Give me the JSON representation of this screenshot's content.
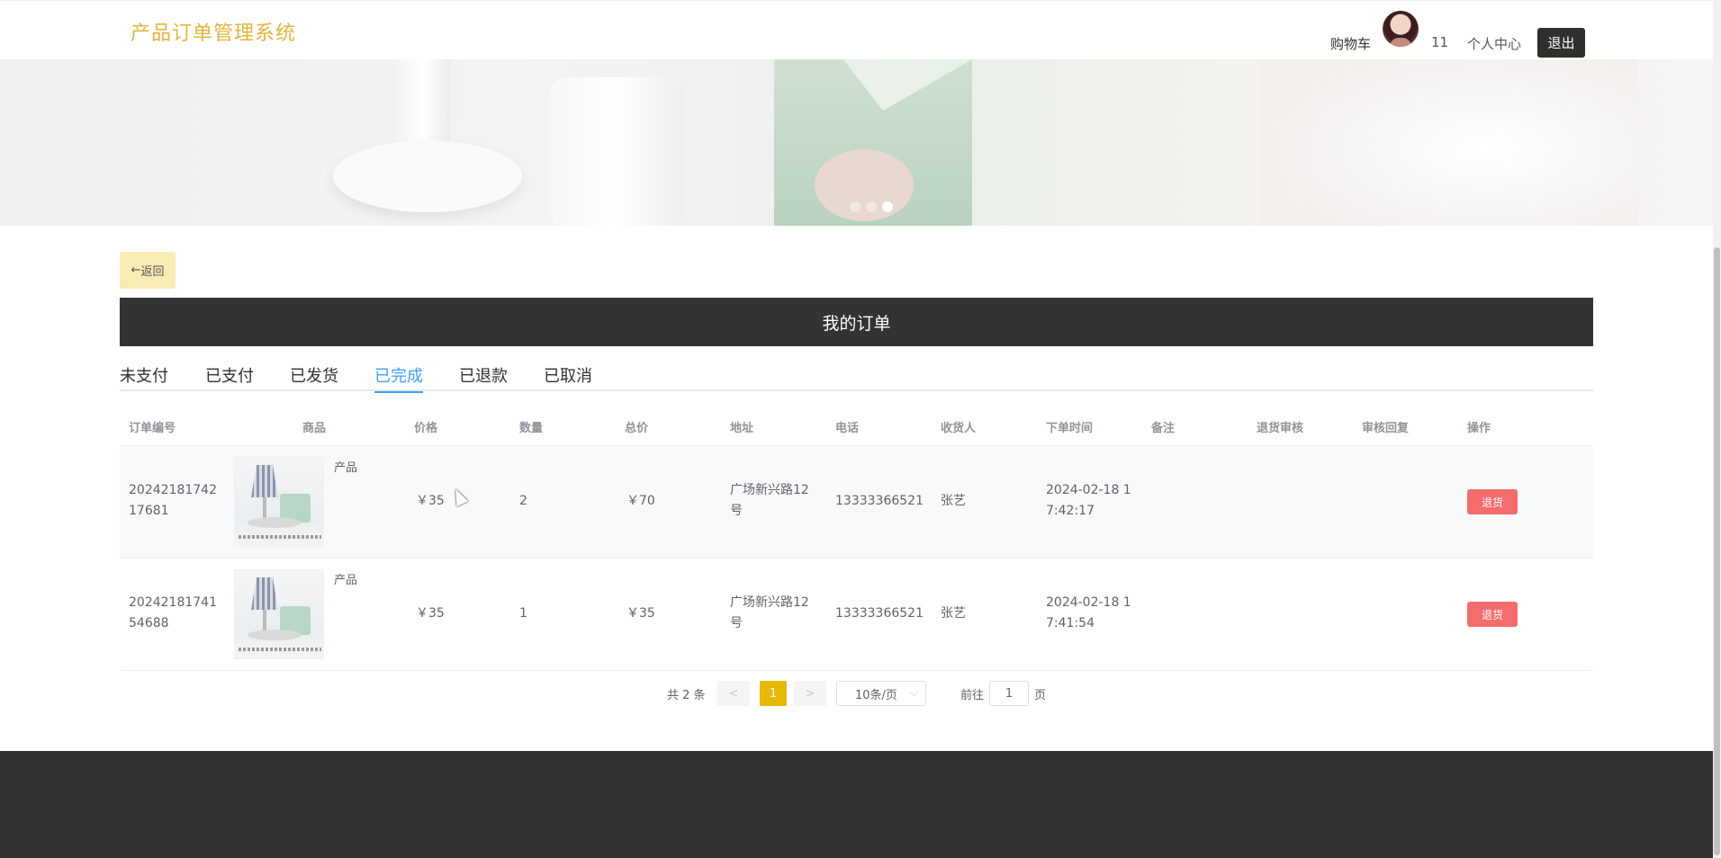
{
  "header": {
    "brand": "产品订单管理系统",
    "cart_label": "购物车",
    "user_count": "11",
    "profile_label": "个人中心",
    "logout_label": "退出"
  },
  "back_label": "返回",
  "page_title": "我的订单",
  "tabs": [
    {
      "label": "未支付",
      "active": false
    },
    {
      "label": "已支付",
      "active": false
    },
    {
      "label": "已发货",
      "active": false
    },
    {
      "label": "已完成",
      "active": true
    },
    {
      "label": "已退款",
      "active": false
    },
    {
      "label": "已取消",
      "active": false
    }
  ],
  "table": {
    "columns": [
      "订单编号",
      "商品",
      "价格",
      "数量",
      "总价",
      "地址",
      "电话",
      "收货人",
      "下单时间",
      "备注",
      "退货审核",
      "审核回复",
      "操作"
    ],
    "rows": [
      {
        "order_no_1": "20242181742",
        "order_no_2": "17681",
        "product": "产品",
        "price": "￥35",
        "qty": "2",
        "total": "￥70",
        "address_1": "广场新兴路12",
        "address_2": "号",
        "phone": "13333366521",
        "receiver": "张艺",
        "time_1": "2024-02-18 1",
        "time_2": "7:42:17",
        "note": "",
        "refund_review": "",
        "review_reply": "",
        "action": "退货"
      },
      {
        "order_no_1": "20242181741",
        "order_no_2": "54688",
        "product": "产品",
        "price": "￥35",
        "qty": "1",
        "total": "￥35",
        "address_1": "广场新兴路12",
        "address_2": "号",
        "phone": "13333366521",
        "receiver": "张艺",
        "time_1": "2024-02-18 1",
        "time_2": "7:41:54",
        "note": "",
        "refund_review": "",
        "review_reply": "",
        "action": "退货"
      }
    ]
  },
  "pagination": {
    "total": "共 2 条",
    "prev": "<",
    "current": "1",
    "next": ">",
    "page_size": "10条/页",
    "goto_label": "前往",
    "goto_value": "1",
    "goto_unit": "页"
  },
  "icons": {
    "back": "arrow-left-icon",
    "select": "chevron-down-icon"
  },
  "colors": {
    "brand": "#e6b53a",
    "dark": "#333333",
    "tab_active": "#409eff",
    "danger": "#f56c6c",
    "page_active": "#e6b800",
    "back_bg": "#f9ebb4"
  }
}
